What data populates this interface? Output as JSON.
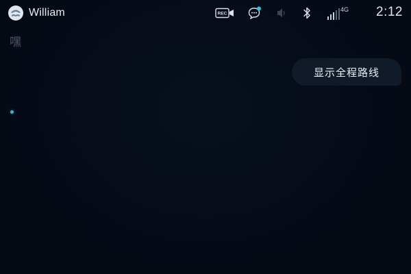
{
  "status_bar": {
    "username": "William",
    "network": "4G",
    "time": "2:12",
    "icons": [
      "avatar",
      "rec-icon",
      "message-icon",
      "volume-icon",
      "bluetooth-icon",
      "signal-icon"
    ]
  },
  "content": {
    "prompt_char": "嘿",
    "route_bubble_label": "显示全程路线"
  },
  "colors": {
    "background": "#050b16",
    "bubble": "#101a28",
    "indicator": "#3fb3c6",
    "message_dot": "#36c2d6"
  }
}
